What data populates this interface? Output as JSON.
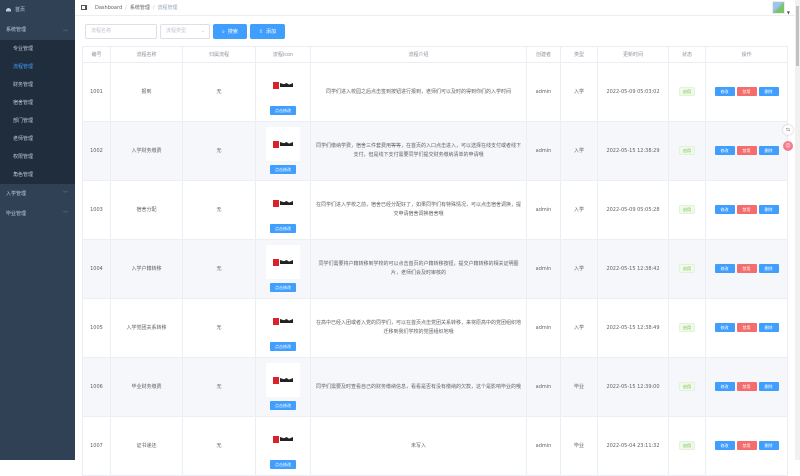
{
  "sidebar": {
    "home": "首页",
    "system": "系统管理",
    "system_items": [
      "专业管理",
      "流程管理",
      "财务管理",
      "宿舍管理",
      "部门管理",
      "老师管理",
      "权限管理",
      "角色管理"
    ],
    "enroll": "入学管理",
    "graduate": "毕业管理"
  },
  "breadcrumb": [
    "Dashboard",
    "系统管理",
    "流程管理"
  ],
  "toolbar": {
    "name_placeholder": "流程名称",
    "type_placeholder": "流程类型",
    "search": "搜索",
    "add": "添加"
  },
  "table": {
    "headers": [
      "编号",
      "流程名称",
      "归属流程",
      "流程icon",
      "流程介绍",
      "创建者",
      "类型",
      "更新时间",
      "状态",
      "操作"
    ],
    "edit_icon_label": "点击修改",
    "actions": [
      "修改",
      "禁用",
      "删除"
    ],
    "rows": [
      {
        "id": "1001",
        "name": "报到",
        "parent": "无",
        "desc": "同学们进入校园之后点击签到按钮进行报到，老师们可以及时的得到你们的入学时间",
        "creator": "admin",
        "type": "入学",
        "updated": "2022-05-09 05:03:02",
        "status": "启用"
      },
      {
        "id": "1002",
        "name": "入学财务缴费",
        "parent": "无",
        "desc": "同学们缴纳学费，宿舍三件套费用等等，在首页的入口点击进入，可以选择在线支付或者线下支付，但是线下支付需要同学们提交财务缴纳清单的申请哦",
        "creator": "admin",
        "type": "入学",
        "updated": "2022-05-15 12:38:29",
        "status": "启用"
      },
      {
        "id": "1003",
        "name": "宿舍分配",
        "parent": "无",
        "desc": "在同学们进入学校之前，宿舍已经分配好了，如果同学们有特殊情况，可以点击宿舍调换，提交申请宿舍调换宿舍哦",
        "creator": "admin",
        "type": "入学",
        "updated": "2022-05-09 05:05:28",
        "status": "启用"
      },
      {
        "id": "1004",
        "name": "入学户籍转移",
        "parent": "无",
        "desc": "同学们需要将户籍转移到学校的可以点击首页的户籍转移按钮，提交户籍转移的相关证明图片，老师们会及时审核的",
        "creator": "admin",
        "type": "入学",
        "updated": "2022-05-15 12:38:42",
        "status": "启用"
      },
      {
        "id": "1005",
        "name": "入学党团关系转移",
        "parent": "无",
        "desc": "在高中已经入团或者入党的同学们，可以在首页点击党团关系转移，来将原高中的党团组织地迁移到我们学校的党团组织地哦",
        "creator": "admin",
        "type": "入学",
        "updated": "2022-05-15 12:38:49",
        "status": "启用"
      },
      {
        "id": "1006",
        "name": "毕业财务缴费",
        "parent": "无",
        "desc": "同学们需要及时查看自己的财务缴纳信息，看看是否有没有缴纳的欠款，这个是影响毕业的哦",
        "creator": "admin",
        "type": "毕业",
        "updated": "2022-05-15 12:39:00",
        "status": "启用"
      },
      {
        "id": "1007",
        "name": "证书递还",
        "parent": "无",
        "desc": "未写入",
        "creator": "admin",
        "type": "毕业",
        "updated": "2022-05-04 23:11:32",
        "status": "启用"
      }
    ]
  }
}
